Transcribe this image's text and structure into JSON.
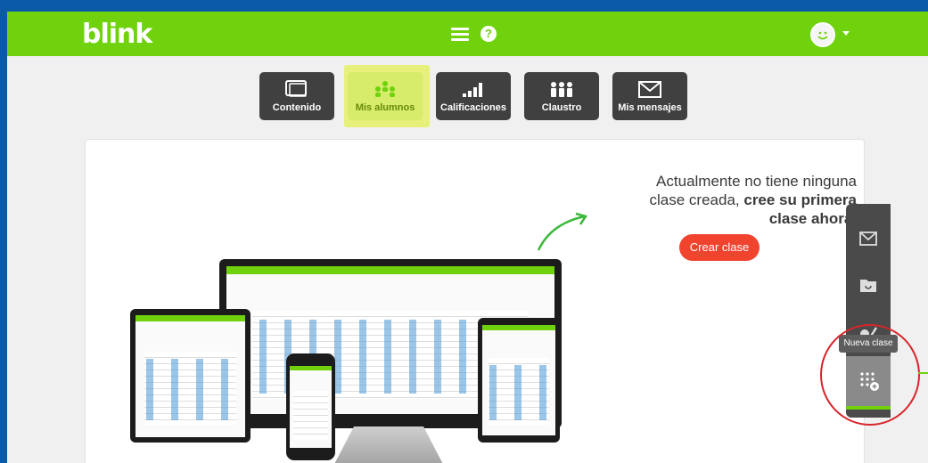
{
  "header": {
    "logo": "blink",
    "help": "?"
  },
  "nav": [
    {
      "label": "Contenido",
      "icon": "monitor-icon"
    },
    {
      "label": "Mis alumnos",
      "icon": "students-icon",
      "active": true
    },
    {
      "label": "Calificaciones",
      "icon": "grades-chart-icon"
    },
    {
      "label": "Claustro",
      "icon": "teachers-icon"
    },
    {
      "label": "Mis mensajes",
      "icon": "envelope-icon"
    }
  ],
  "main": {
    "message_line1": "Actualmente no tiene ninguna",
    "message_line2": "clase creada, ",
    "message_bold1": "cree su primera",
    "message_bold2": "clase ahora.",
    "crear_button": "Crear clase"
  },
  "sidebar": {
    "tooltip": "Nueva clase",
    "icons": [
      "envelope-icon",
      "folder-sync-icon",
      "edit-icon",
      "new-class-icon"
    ]
  },
  "colors": {
    "brand_green": "#6fd20d",
    "button_red": "#f0442f",
    "nav_dark": "#404040",
    "active_yellow": "#e6f07a"
  }
}
